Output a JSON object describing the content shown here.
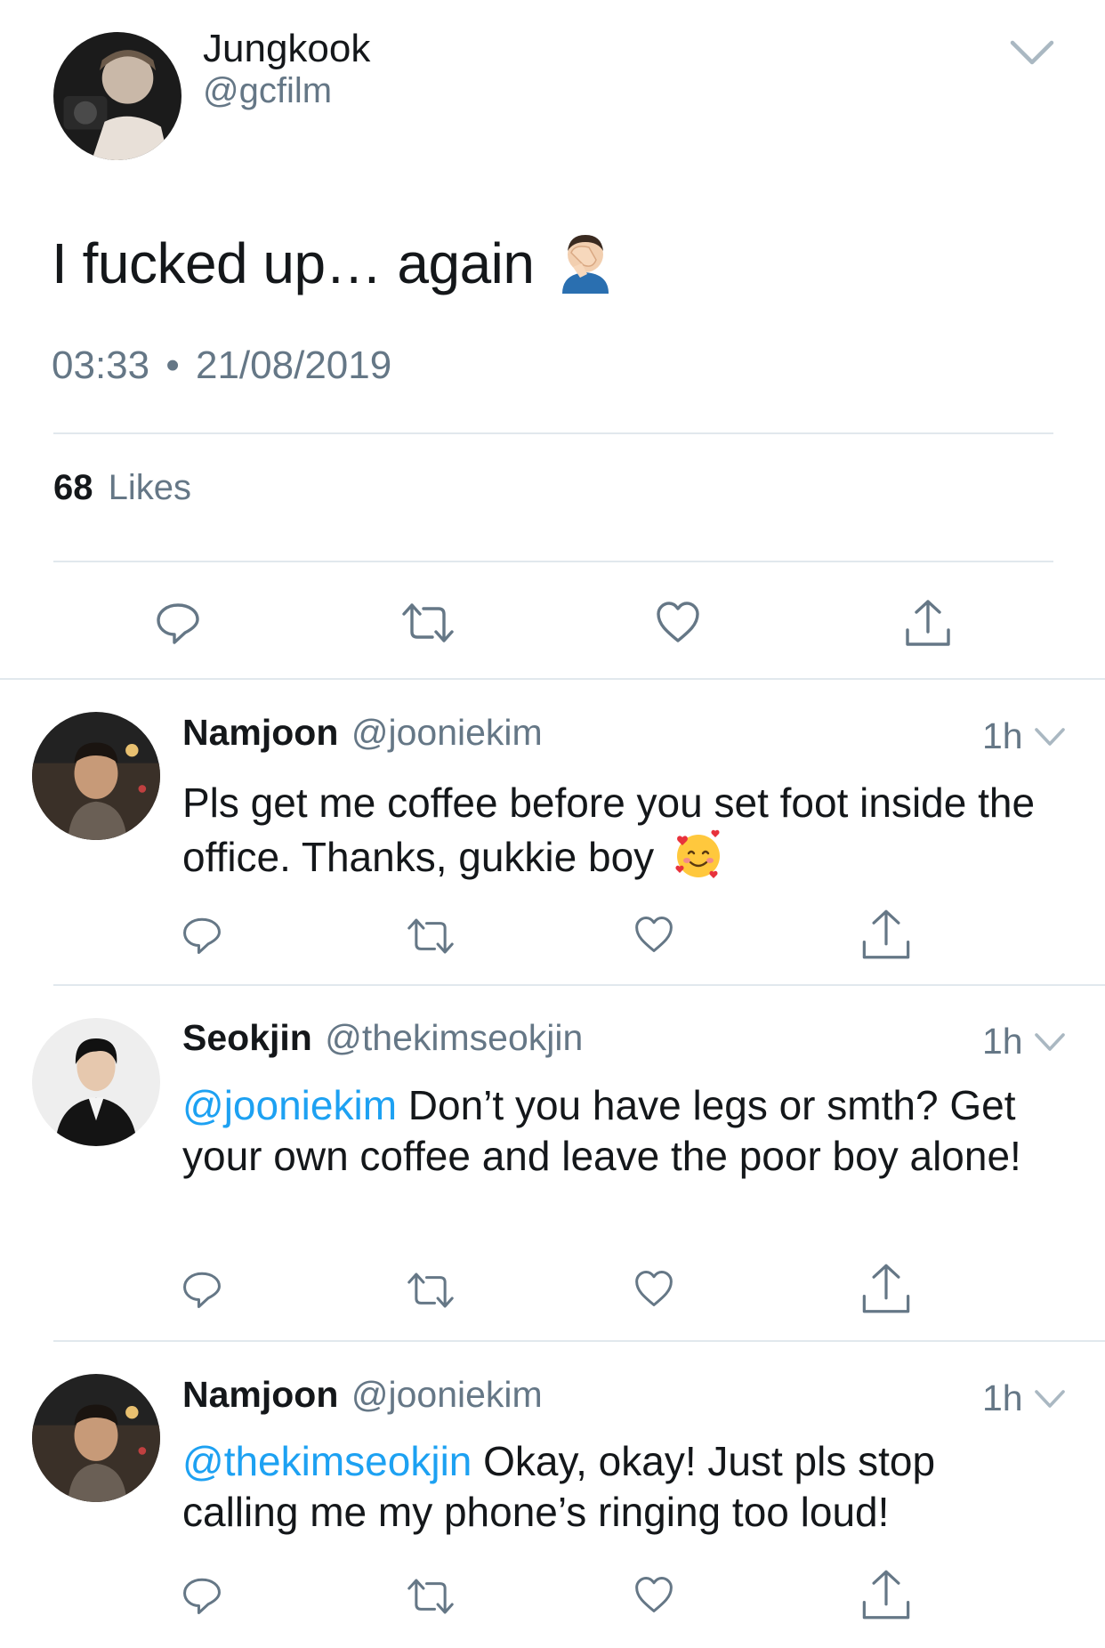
{
  "main_tweet": {
    "name": "Jungkook",
    "handle": "@gcfilm",
    "text": "I fucked up… again",
    "text_emoji": "man-facepalming",
    "time": "03:33",
    "separator": "•",
    "date": "21/08/2019",
    "likes_count": "68",
    "likes_label": "Likes"
  },
  "replies": [
    {
      "name": "Namjoon",
      "handle": "@jooniekim",
      "time": "1h",
      "mention": "",
      "text": "Pls get me coffee before you set foot inside the office. Thanks, gukkie boy",
      "emoji": "smiling-face-with-hearts"
    },
    {
      "name": "Seokjin",
      "handle": "@thekimseokjin",
      "time": "1h",
      "mention": "@jooniekim",
      "text": " Don’t you have legs or smth? Get your own coffee and leave the poor boy alone!"
    },
    {
      "name": "Namjoon",
      "handle": "@jooniekim",
      "time": "1h",
      "mention": "@thekimseokjin",
      "text": " Okay, okay! Just pls stop calling me my phone’s ringing too loud!"
    }
  ],
  "icons": {
    "reply": "reply-icon",
    "retweet": "retweet-icon",
    "like": "heart-icon",
    "share": "share-icon",
    "caret": "chevron-down-icon"
  },
  "colors": {
    "text": "#14171a",
    "muted": "#657786",
    "mention": "#1da1f2",
    "divider": "#e1e8ed"
  }
}
